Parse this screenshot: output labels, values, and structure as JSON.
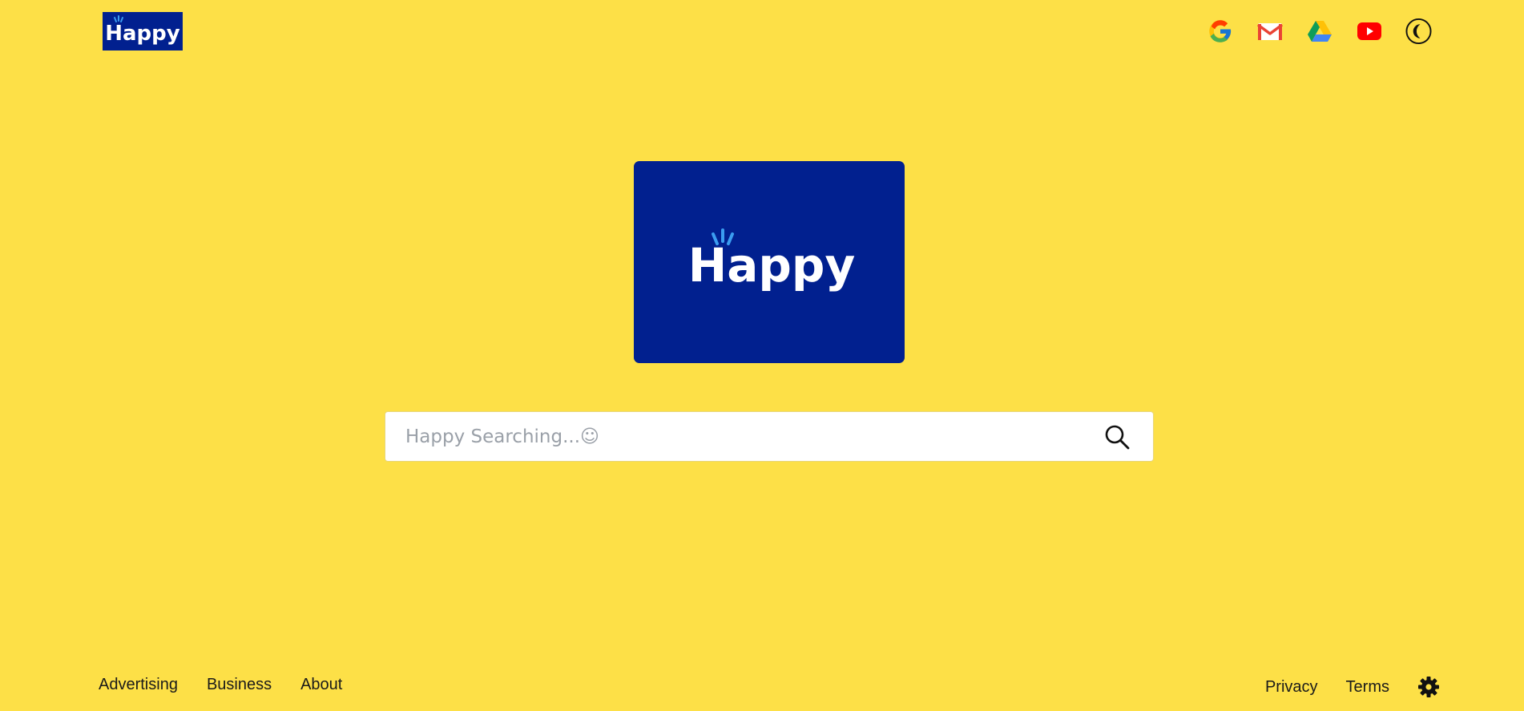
{
  "header": {
    "logo_text": "Happy",
    "icons": [
      {
        "name": "google-icon"
      },
      {
        "name": "gmail-icon"
      },
      {
        "name": "drive-icon"
      },
      {
        "name": "youtube-icon"
      },
      {
        "name": "dark-mode-icon"
      }
    ]
  },
  "main": {
    "logo_text": "Happy",
    "logo_bg": "#01208f",
    "search": {
      "placeholder": "Happy Searching...☺",
      "value": ""
    }
  },
  "footer": {
    "left_links": [
      "Advertising",
      "Business",
      "About"
    ],
    "right_links": [
      "Privacy",
      "Terms"
    ]
  },
  "colors": {
    "background": "#fde047",
    "logo_blue": "#01208f",
    "accent_light_blue": "#3b9df0"
  }
}
